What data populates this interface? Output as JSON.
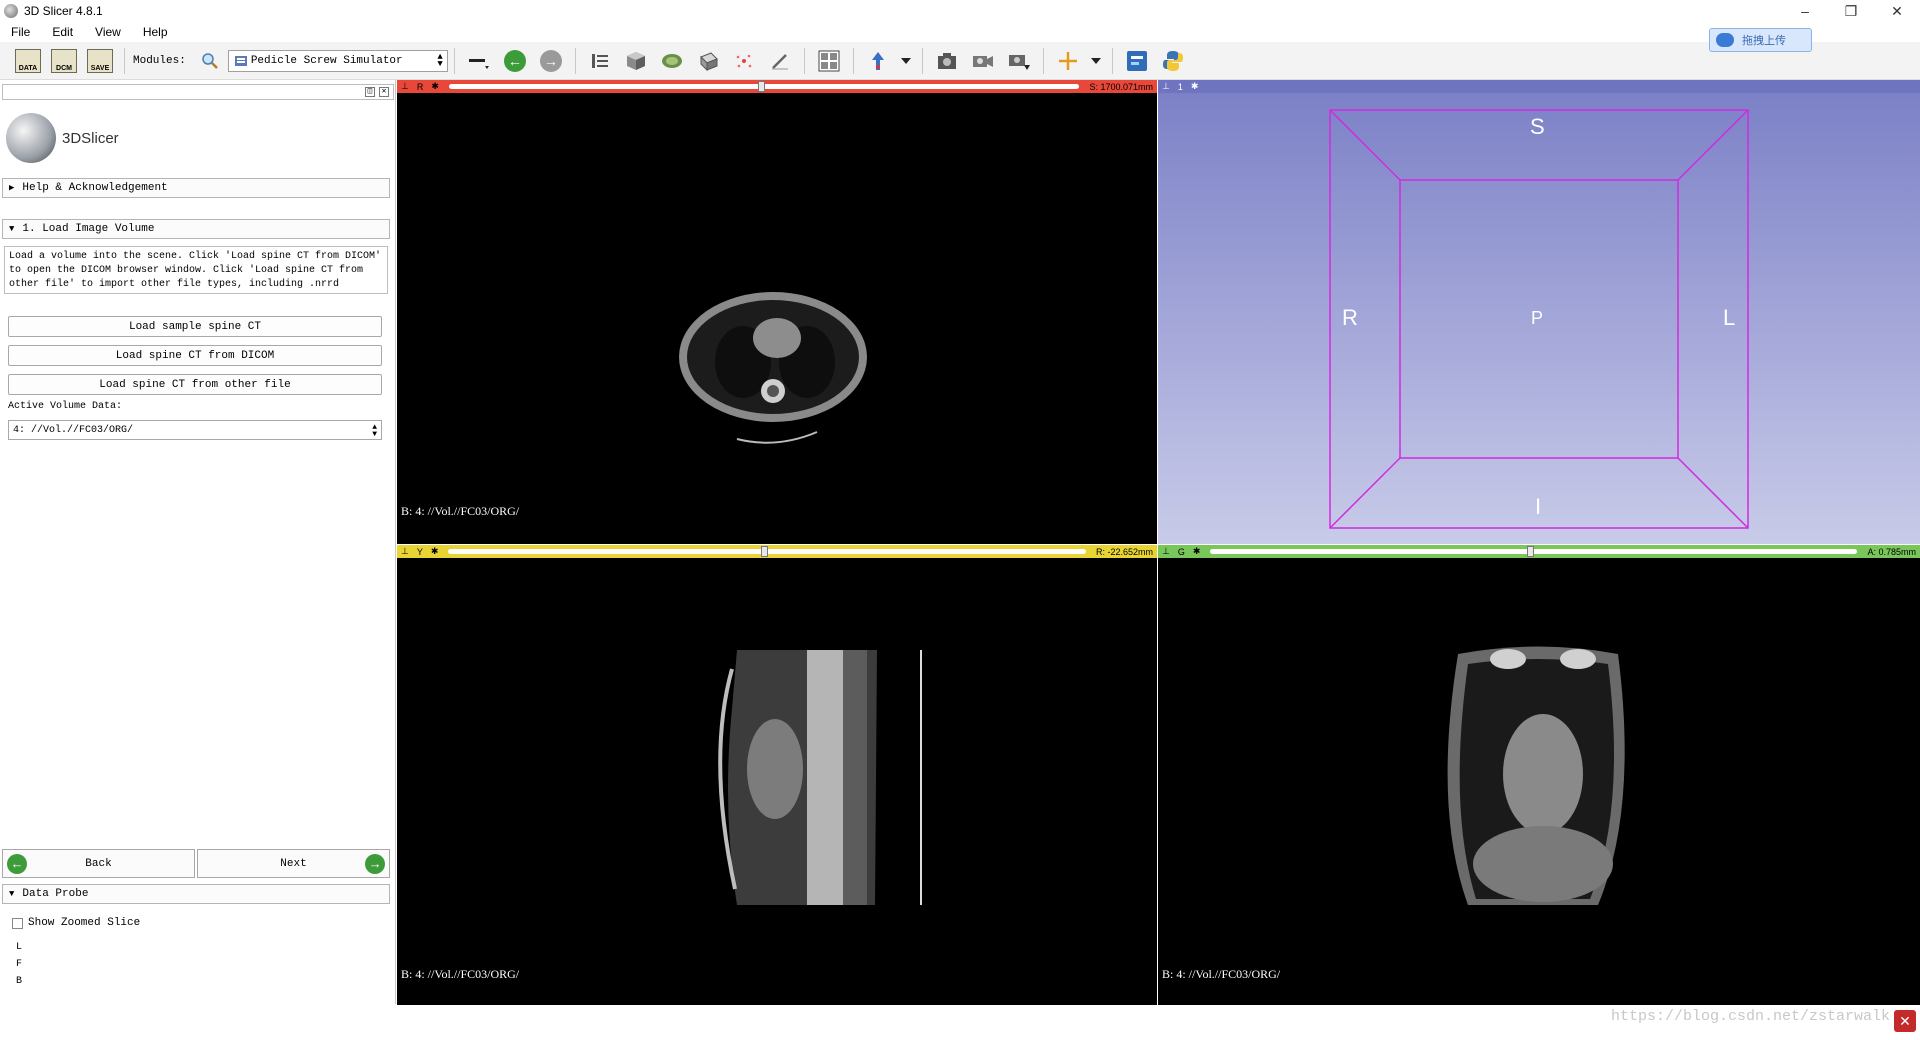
{
  "window": {
    "title": "3D Slicer 4.8.1",
    "controls": [
      "–",
      "❐",
      "✕"
    ]
  },
  "menu": [
    "File",
    "Edit",
    "View",
    "Help"
  ],
  "toolbar": {
    "data_label": "DATA",
    "dcm_label": "DCM",
    "save_label": "SAVE",
    "modules_label": "Modules:",
    "module_selected": "Pedicle Screw Simulator"
  },
  "cloud_button": {
    "label": "拖拽上传"
  },
  "left_panel": {
    "logo_text": "3DSlicer",
    "help_section": "Help & Acknowledgement",
    "load_section": "1. Load Image Volume",
    "description": "Load a volume into the scene. Click 'Load spine CT from DICOM' to open the DICOM browser window. Click 'Load spine CT from other file' to import other file types, including .nrrd",
    "buttons": [
      "Load sample spine CT",
      "Load spine CT from DICOM",
      "Load spine CT from other file"
    ],
    "active_volume_label": "Active Volume Data:",
    "active_volume_value": "4: //Vol.//FC03/ORG/",
    "back_label": "Back",
    "next_label": "Next",
    "data_probe_section": "Data Probe",
    "show_zoomed_slice": "Show Zoomed Slice",
    "probe_lines": [
      "L",
      "F",
      "B"
    ]
  },
  "views": {
    "red": {
      "letter": "R",
      "readout": "S: 1700.071mm",
      "caption": "B: 4: //Vol.//FC03/ORG/",
      "bar_color": "#e8483a",
      "slider_fraction": 0.5
    },
    "yellow": {
      "letter": "Y",
      "readout": "R: -22.652mm",
      "caption": "B: 4: //Vol.//FC03/ORG/",
      "bar_color": "#e8d534",
      "slider_fraction": 0.5
    },
    "green": {
      "letter": "G",
      "readout": "A: 0.785mm",
      "caption": "B: 4: //Vol.//FC03/ORG/",
      "bar_color": "#79c75a",
      "slider_fraction": 0.5
    },
    "three_d": {
      "number": "1",
      "labels": {
        "top": "S",
        "bottom": "I",
        "left": "R",
        "right": "L",
        "center": "P"
      }
    }
  },
  "watermark": "https://blog.csdn.net/zstarwalk"
}
